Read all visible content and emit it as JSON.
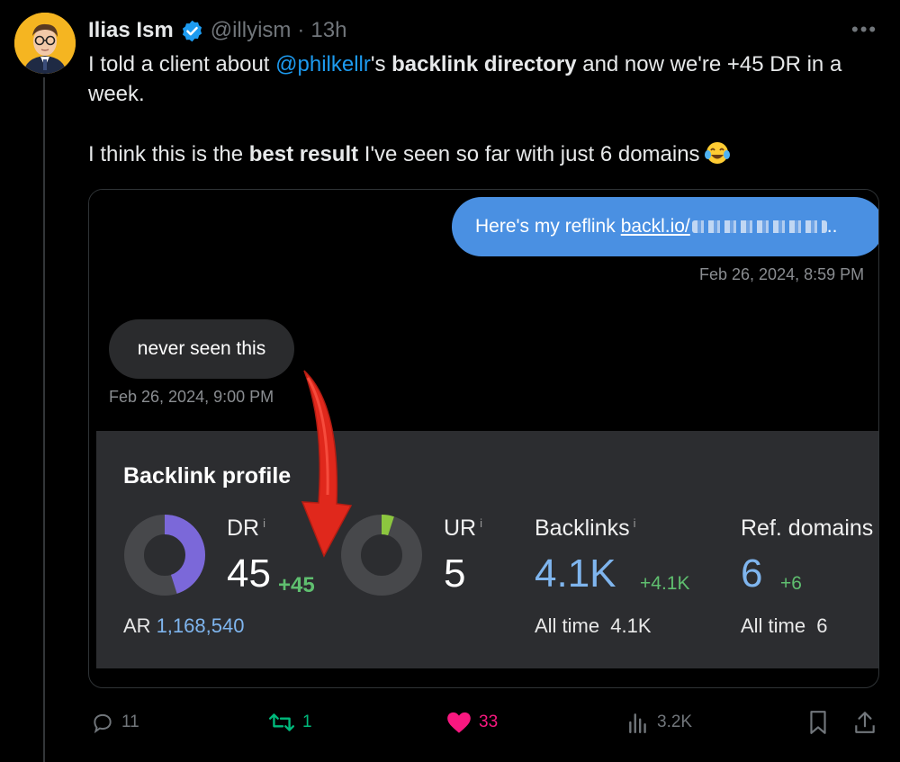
{
  "author": {
    "name": "Ilias Ism",
    "handle": "@illyism",
    "separator": "·",
    "time": "13h"
  },
  "tweet": {
    "line1_pre": "I told a client about ",
    "mention": "@philkellr",
    "line1_mid": "'s ",
    "line1_bold": "backlink directory",
    "line1_post": " and now we're +45 DR in a week.",
    "line2_pre": "I think this is the ",
    "line2_bold": "best result",
    "line2_post": " I've seen so far with just 6 domains"
  },
  "chat": {
    "outgoing_text": "Here's my reflink",
    "outgoing_link": "backl.io/",
    "outgoing_tail": "..",
    "outgoing_time": "Feb 26, 2024, 8:59 PM",
    "incoming_text": "never seen this",
    "incoming_time": "Feb 26, 2024, 9:00 PM"
  },
  "backlink_profile": {
    "title": "Backlink profile",
    "info_glyph": "i",
    "dr": {
      "label": "DR",
      "value": "45",
      "delta": "+45",
      "fill_fraction": 0.45
    },
    "ar": {
      "label": "AR",
      "value": "1,168,540"
    },
    "ur": {
      "label": "UR",
      "value": "5",
      "fill_fraction": 0.05
    },
    "backlinks": {
      "label": "Backlinks",
      "value": "4.1K",
      "delta": "+4.1K",
      "all_time_label": "All time",
      "all_time_value": "4.1K"
    },
    "ref_domains": {
      "label": "Ref. domains",
      "value": "6",
      "delta": "+6",
      "all_time_label": "All time",
      "all_time_value": "6"
    }
  },
  "actions": {
    "replies": "11",
    "reposts": "1",
    "likes": "33",
    "views": "3.2K"
  },
  "colors": {
    "mention": "#1d9bf0",
    "outgoing_bubble": "#4a90e2",
    "repost": "#00ba7c",
    "like": "#f91880",
    "dr_donut": "#7b68d9",
    "ur_donut": "#8cc63f",
    "delta_green": "#5fbf6f",
    "arrow_red": "#e0281c"
  },
  "icons": [
    "verified-badge-icon",
    "more-icon",
    "reply-icon",
    "repost-icon",
    "like-icon",
    "views-icon",
    "bookmark-icon",
    "share-icon",
    "info-icon",
    "tears-of-joy-emoji"
  ]
}
